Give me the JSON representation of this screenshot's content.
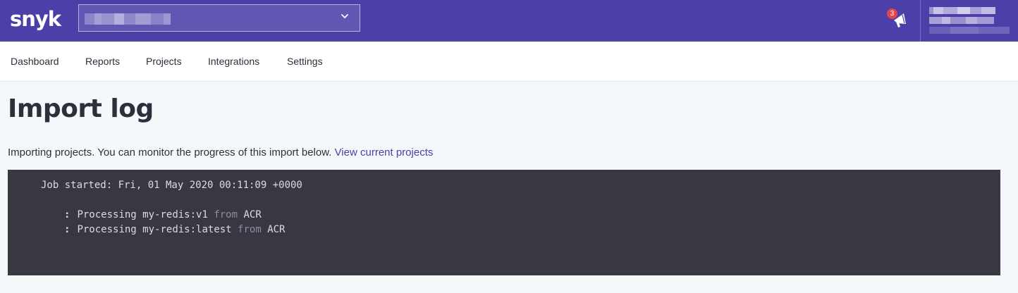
{
  "topbar": {
    "logo_text": "snyk",
    "org_selector": {
      "value": ""
    },
    "notifications": {
      "count": "3",
      "icon": "megaphone-icon"
    },
    "colors": {
      "background": "#4c3fa8",
      "badge": "#e0454d"
    }
  },
  "nav": {
    "items": [
      {
        "label": "Dashboard"
      },
      {
        "label": "Reports"
      },
      {
        "label": "Projects"
      },
      {
        "label": "Integrations"
      },
      {
        "label": "Settings"
      }
    ]
  },
  "page": {
    "title": "Import log",
    "intro_text": "Importing projects. You can monitor the progress of this import below.",
    "intro_link": "View current projects"
  },
  "log": {
    "job_started": "Job started: Fri, 01 May 2020 00:11:09 +0000",
    "entries": [
      {
        "prefix": "Processing",
        "name": "my-redis:v1",
        "from": "from",
        "source": "ACR"
      },
      {
        "prefix": "Processing",
        "name": "my-redis:latest",
        "from": "from",
        "source": "ACR"
      }
    ]
  }
}
